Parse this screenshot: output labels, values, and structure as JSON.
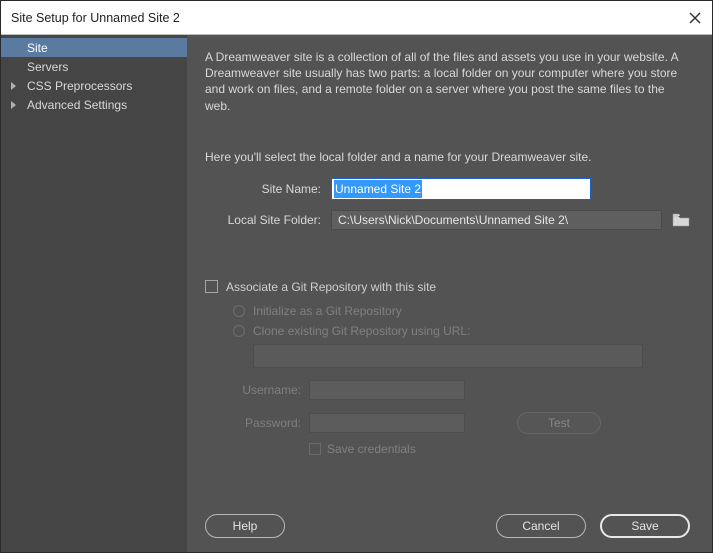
{
  "titlebar": {
    "text": "Site Setup for Unnamed Site 2"
  },
  "sidebar": {
    "items": [
      {
        "label": "Site",
        "active": true,
        "expandable": false
      },
      {
        "label": "Servers",
        "active": false,
        "expandable": false
      },
      {
        "label": "CSS Preprocessors",
        "active": false,
        "expandable": true
      },
      {
        "label": "Advanced Settings",
        "active": false,
        "expandable": true
      }
    ]
  },
  "main": {
    "intro": "A Dreamweaver site is a collection of all of the files and assets you use in your website. A Dreamweaver site usually has two parts: a local folder on your computer where you store and work on files, and a remote folder on a server where you post the same files to the web.",
    "subIntro": "Here you'll select the local folder and a name for your Dreamweaver site.",
    "siteNameLabel": "Site Name:",
    "siteNameValue": "Unnamed Site 2",
    "folderLabel": "Local Site Folder:",
    "folderValue": "C:\\Users\\Nick\\Documents\\Unnamed Site 2\\",
    "git": {
      "associate": "Associate a Git Repository with this site",
      "init": "Initialize as a Git Repository",
      "clone": "Clone existing Git Repository using URL:",
      "usernameLabel": "Username:",
      "passwordLabel": "Password:",
      "test": "Test",
      "saveCred": "Save credentials"
    }
  },
  "footer": {
    "help": "Help",
    "cancel": "Cancel",
    "save": "Save"
  }
}
